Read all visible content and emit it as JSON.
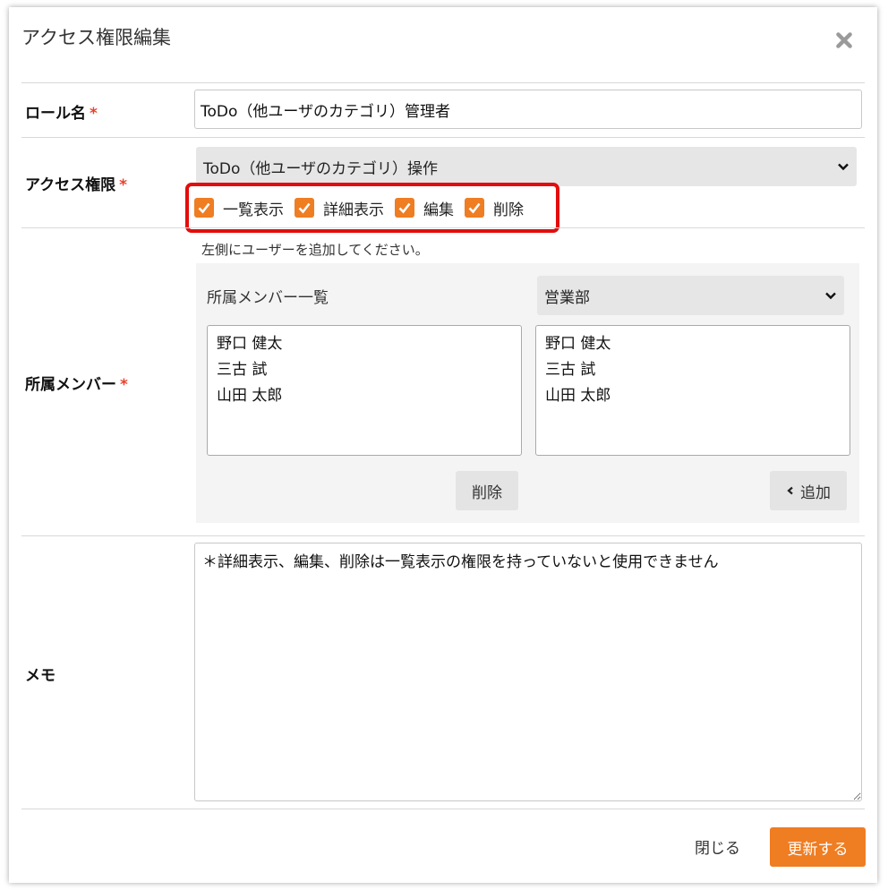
{
  "dialog": {
    "title": "アクセス権限編集"
  },
  "fields": {
    "role_name": {
      "label": "ロール名",
      "required_mark": "*",
      "value": "ToDo（他ユーザのカテゴリ）管理者"
    },
    "access": {
      "label": "アクセス権限",
      "required_mark": "*",
      "selected": "ToDo（他ユーザのカテゴリ）操作",
      "permissions": [
        {
          "label": "一覧表示",
          "checked": true
        },
        {
          "label": "詳細表示",
          "checked": true
        },
        {
          "label": "編集",
          "checked": true
        },
        {
          "label": "削除",
          "checked": true
        }
      ]
    },
    "members": {
      "label": "所属メンバー",
      "required_mark": "*",
      "hint": "左側にユーザーを追加してください。",
      "list_title": "所属メンバー一覧",
      "department": "営業部",
      "assigned": [
        "野口 健太",
        "三古 試",
        "山田 太郎"
      ],
      "available": [
        "野口 健太",
        "三古 試",
        "山田 太郎"
      ],
      "remove_label": "削除",
      "add_label": "追加"
    },
    "memo": {
      "label": "メモ",
      "value": "＊詳細表示、編集、削除は一覧表示の権限を持っていないと使用できません"
    }
  },
  "footer": {
    "close_label": "閉じる",
    "submit_label": "更新する"
  },
  "colors": {
    "accent": "#ef7d22",
    "required": "#e8412c",
    "highlight_border": "#e30d0d"
  }
}
